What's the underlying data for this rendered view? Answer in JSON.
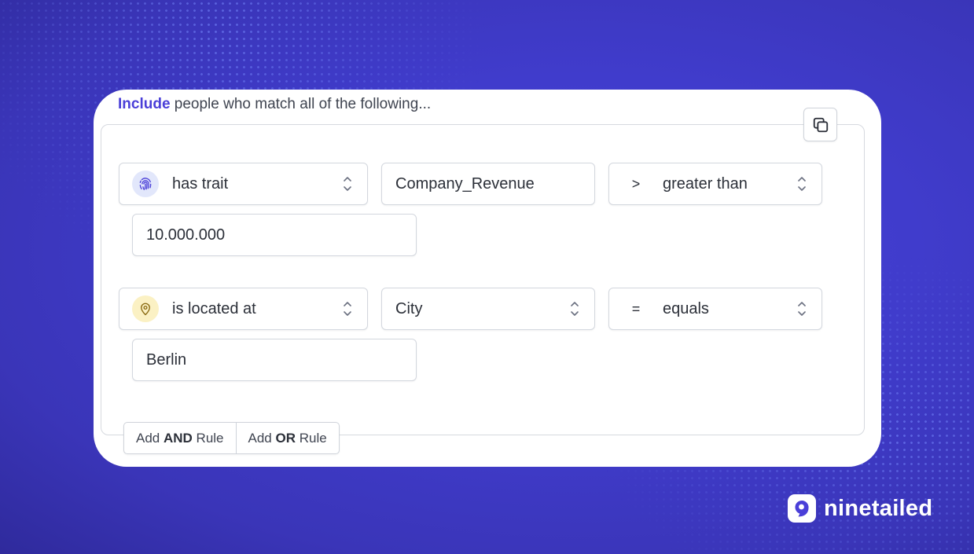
{
  "header": {
    "highlight": "Include",
    "rest": " people who match all of the following..."
  },
  "rules": [
    {
      "condition": "has trait",
      "condition_icon": "fingerprint-icon",
      "property": "Company_Revenue",
      "operator_symbol": ">",
      "operator_label": "greater than",
      "value": "10.000.000"
    },
    {
      "condition": "is located at",
      "condition_icon": "map-pin-icon",
      "property": "City",
      "operator_symbol": "=",
      "operator_label": "equals",
      "value": "Berlin"
    }
  ],
  "actions": {
    "and_prefix": "Add ",
    "and_bold": "AND",
    "and_suffix": " Rule",
    "or_prefix": "Add ",
    "or_bold": "OR",
    "or_suffix": " Rule"
  },
  "brand": {
    "name": "ninetailed"
  },
  "colors": {
    "accent": "#4a3fd8",
    "background": "#403ccc",
    "trait_icon_bg": "#e2e7fb",
    "location_icon_bg": "#fbf1c4"
  }
}
